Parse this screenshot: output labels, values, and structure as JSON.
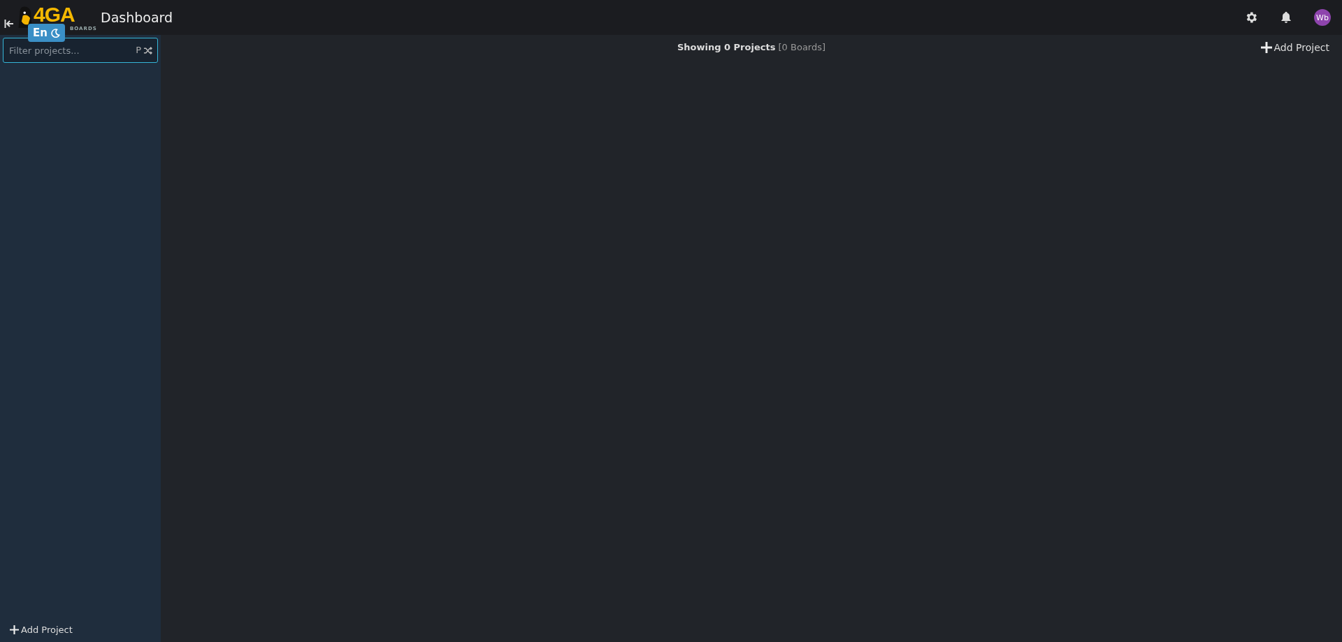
{
  "header": {
    "logo": {
      "main": "4GA",
      "sub": "BOARDS"
    },
    "title": "Dashboard",
    "avatar": "Wb"
  },
  "toggle": {
    "language": "En"
  },
  "sidebar": {
    "filter": {
      "placeholder": "Filter projects...",
      "shortcut": "P"
    },
    "add_label": "Add Project"
  },
  "main": {
    "summary": "**Showing 0 Projects** [0 Boards]",
    "add_label": "Add Project"
  }
}
